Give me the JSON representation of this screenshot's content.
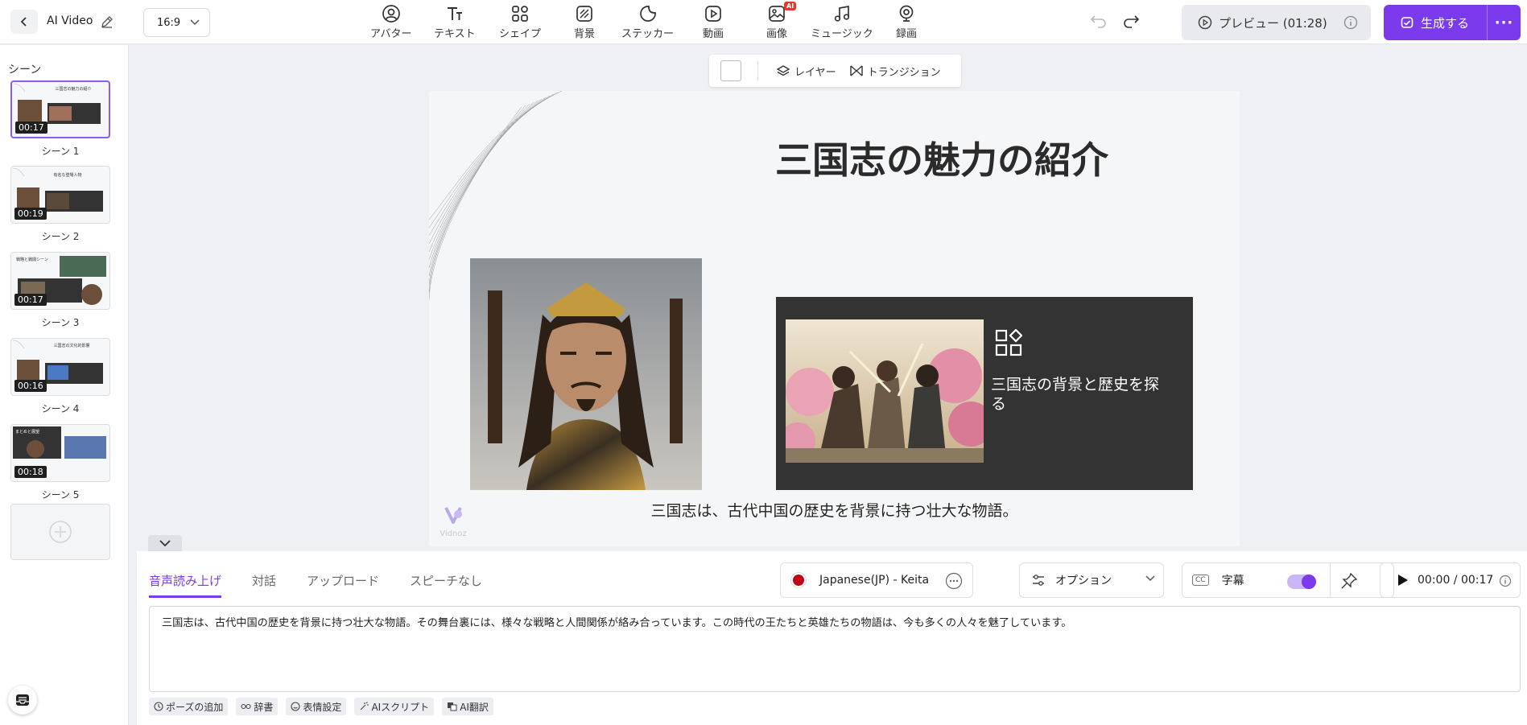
{
  "header": {
    "app_title": "AI Video",
    "aspect_ratio": "16:9",
    "tools": [
      {
        "label": "アバター",
        "icon": "avatar-icon"
      },
      {
        "label": "テキスト",
        "icon": "text-icon"
      },
      {
        "label": "シェイプ",
        "icon": "shape-icon"
      },
      {
        "label": "背景",
        "icon": "background-icon"
      },
      {
        "label": "ステッカー",
        "icon": "sticker-icon"
      },
      {
        "label": "動画",
        "icon": "video-icon"
      },
      {
        "label": "画像",
        "icon": "image-icon",
        "badge": "AI"
      },
      {
        "label": "ミュージック",
        "icon": "music-icon"
      },
      {
        "label": "録画",
        "icon": "record-icon"
      }
    ],
    "preview_label": "プレビュー (01:28)",
    "generate_label": "生成する",
    "more_label": "···"
  },
  "sidebar": {
    "title": "シーン",
    "scenes": [
      {
        "name": "シーン 1",
        "duration": "00:17",
        "thumb_title": "三国志の魅力の紹介"
      },
      {
        "name": "シーン 2",
        "duration": "00:19",
        "thumb_title": "有名な登場人物"
      },
      {
        "name": "シーン 3",
        "duration": "00:17",
        "thumb_title": "戦略と戦闘シーン"
      },
      {
        "name": "シーン 4",
        "duration": "00:16",
        "thumb_title": "三国志の文化的影響"
      },
      {
        "name": "シーン 5",
        "duration": "00:18",
        "thumb_title": "まとめと展望"
      }
    ]
  },
  "canvas_toolbar": {
    "layer_label": "レイヤー",
    "transition_label": "トランジション"
  },
  "slide": {
    "title": "三国志の魅力の紹介",
    "card_text": "三国志の背景と歴史を探る",
    "subtitle": "三国志は、古代中国の歴史を背景に持つ壮大な物語。",
    "watermark": "Vidnoz"
  },
  "bottom": {
    "tabs": [
      "音声読み上げ",
      "対話",
      "アップロード",
      "スピーチなし"
    ],
    "active_tab": 0,
    "voice": "Japanese(JP) - Keita",
    "options_label": "オプション",
    "caption_label": "字幕",
    "caption_enabled": true,
    "time": "00:00 / 00:17",
    "script": "三国志は、古代中国の歴史を背景に持つ壮大な物語。その舞台裏には、様々な戦略と人間関係が絡み合っています。この時代の王たちと英雄たちの物語は、今も多くの人々を魅了しています。",
    "chips": [
      {
        "label": "ポーズの追加",
        "icon": "pause-icon"
      },
      {
        "label": "辞書",
        "icon": "dictionary-icon"
      },
      {
        "label": "表情設定",
        "icon": "expression-icon"
      },
      {
        "label": "AIスクリプト",
        "icon": "ai-script-icon"
      },
      {
        "label": "AI翻訳",
        "icon": "ai-translate-icon"
      }
    ]
  },
  "colors": {
    "accent": "#7c3aed",
    "card_bg": "#333333",
    "slide_bg": "#f5f6f8"
  }
}
